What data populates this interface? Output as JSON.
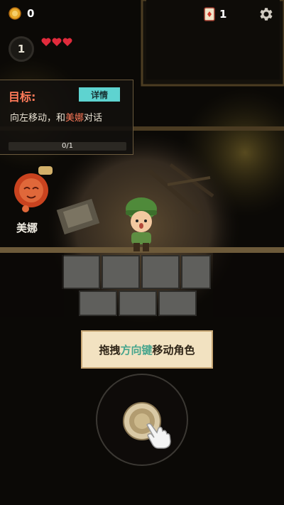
{
  "hud": {
    "coins": "0",
    "cards": "1",
    "level": "1",
    "hearts": [
      "heart-icon",
      "heart-icon",
      "heart-icon"
    ],
    "settings_icon": "gear-icon"
  },
  "objective": {
    "title": "目标:",
    "detail_label": "详情",
    "desc_prefix": "向左移动，和",
    "desc_highlight": "美娜",
    "desc_suffix": "对话",
    "progress_text": "0/1",
    "progress": 0
  },
  "npc": {
    "name": "美娜"
  },
  "tutorial": {
    "hint_prefix": "拖拽",
    "hint_highlight": "方向键",
    "hint_suffix": "移动角色"
  },
  "colors": {
    "accent": "#ff7a59",
    "detail_button": "#5ed3d0",
    "hint_highlight": "#46a58d",
    "heart": "#e02b3c"
  }
}
